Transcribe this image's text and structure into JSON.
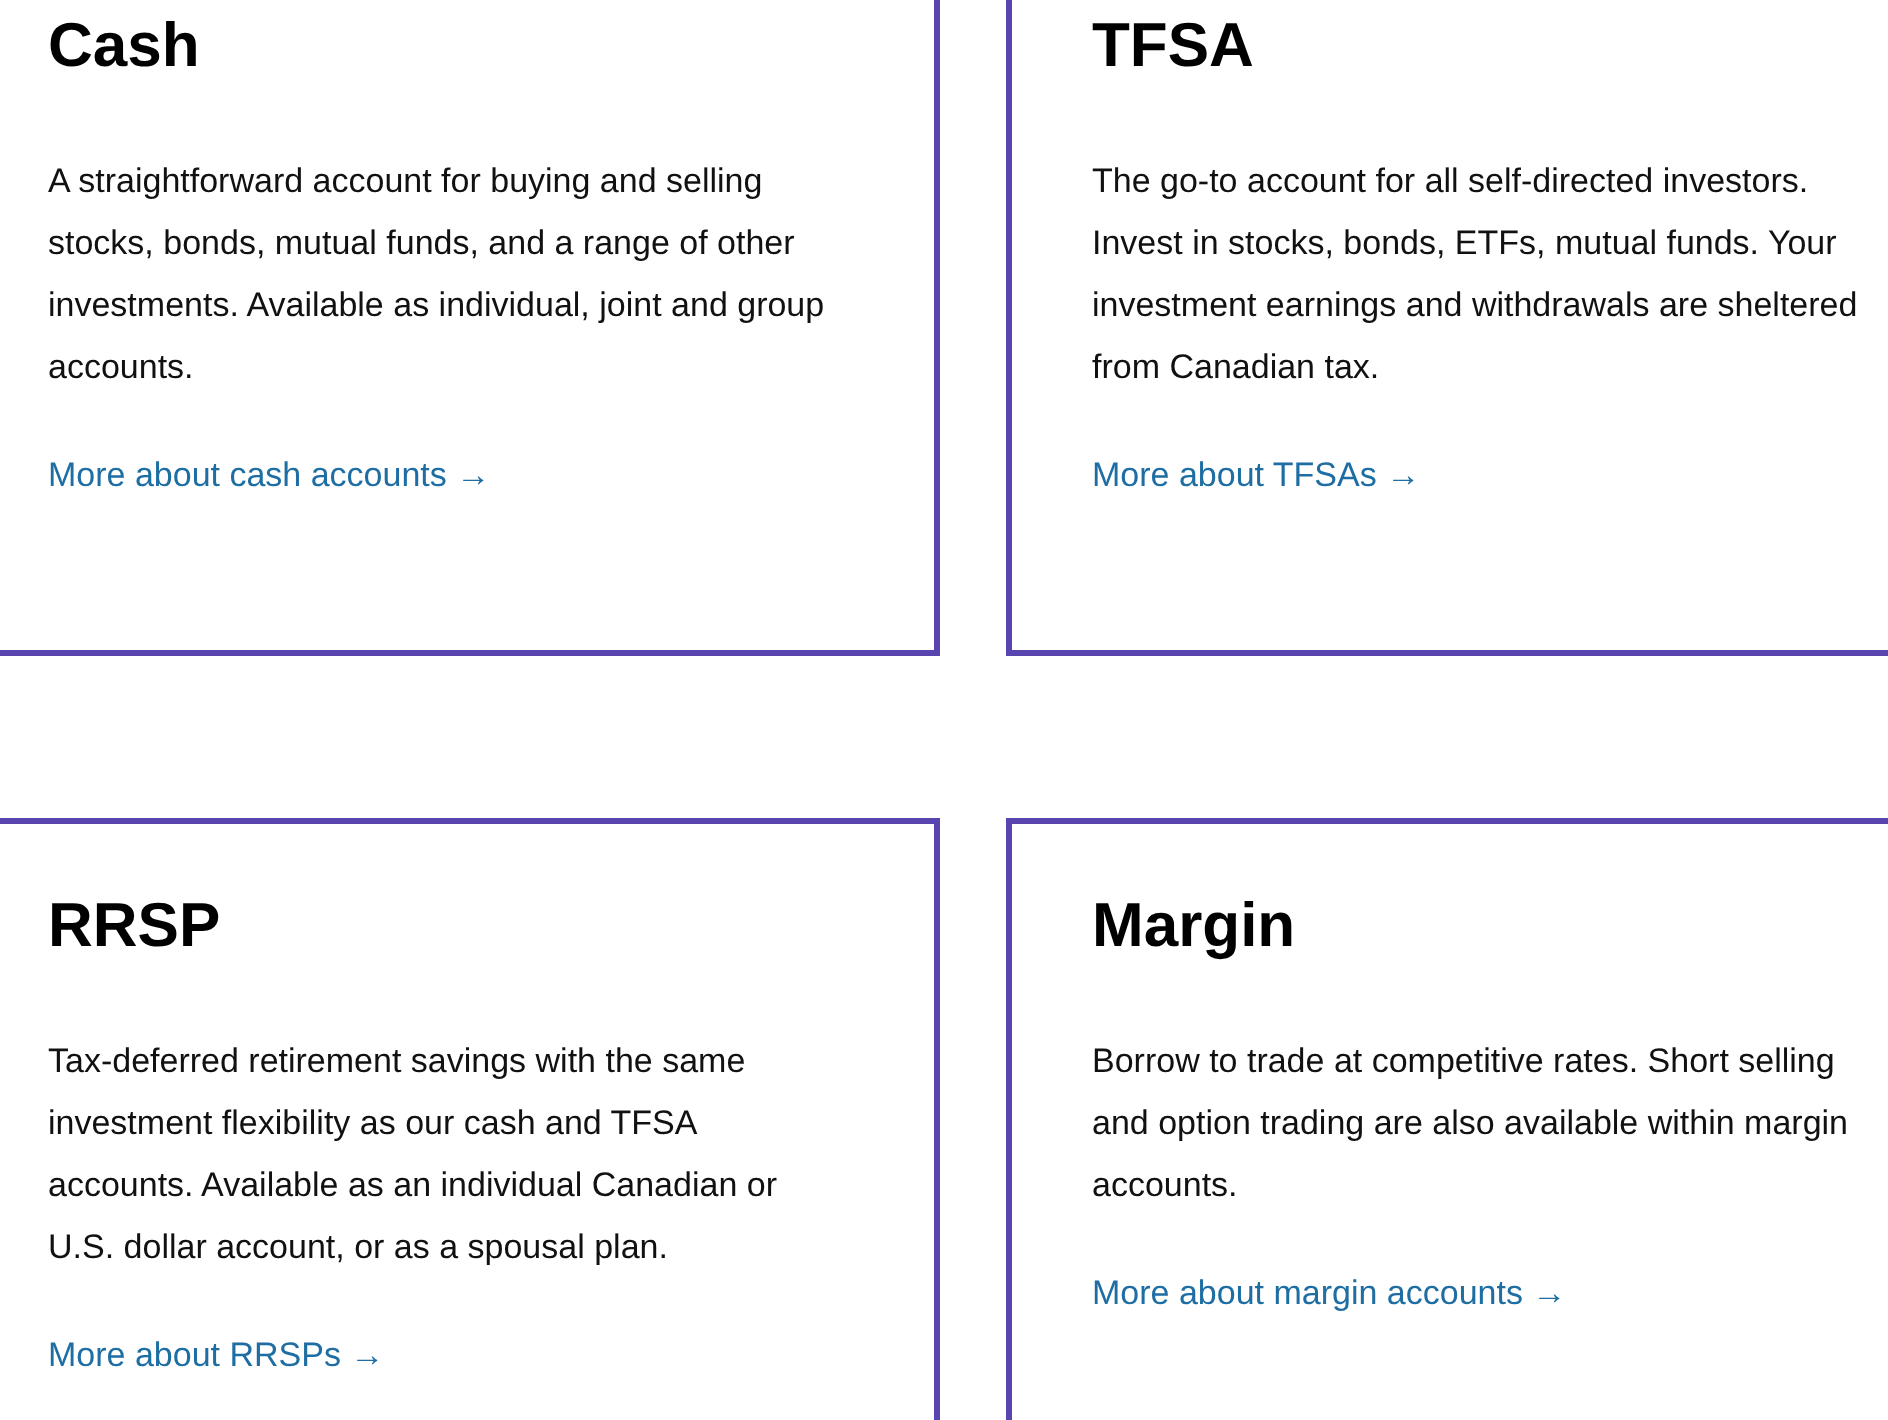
{
  "cards": [
    {
      "title": "Cash",
      "description": "A straightforward account for buying and selling stocks, bonds, mutual funds, and a range of other investments. Available as individual, joint and group accounts.",
      "link": "More about cash accounts →"
    },
    {
      "title": "TFSA",
      "description": "The go-to account for all self-directed investors. Invest in stocks, bonds, ETFs, mutual funds. Your investment earnings and withdrawals are sheltered from Canadian tax.",
      "link": "More about TFSAs →"
    },
    {
      "title": "RRSP",
      "description": "Tax-deferred retirement savings with the same investment flexibility as our cash and TFSA accounts. Available as an individual Canadian or U.S. dollar account, or as a spousal plan.",
      "link": "More about RRSPs →"
    },
    {
      "title": "Margin",
      "description": "Borrow to trade at competitive rates. Short selling and option trading are also available within margin accounts.",
      "link": "More about margin accounts →"
    }
  ]
}
